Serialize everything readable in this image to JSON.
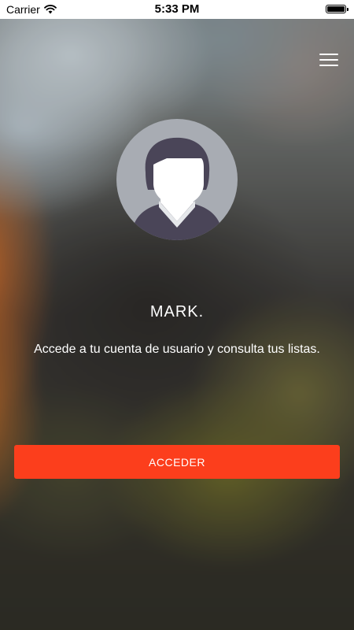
{
  "status_bar": {
    "carrier": "Carrier",
    "time": "5:33 PM",
    "battery_level": 1.0
  },
  "header": {
    "menu_icon": "hamburger-menu-icon"
  },
  "profile": {
    "avatar_icon": "user-avatar-icon",
    "name": "MARK.",
    "description": "Accede a tu cuenta de usuario y consulta tus listas."
  },
  "actions": {
    "login_label": "ACCEDER"
  },
  "colors": {
    "accent": "#fc3e1c",
    "avatar_background": "#a8acb3",
    "avatar_hair": "#4a4558",
    "text": "#ffffff"
  }
}
